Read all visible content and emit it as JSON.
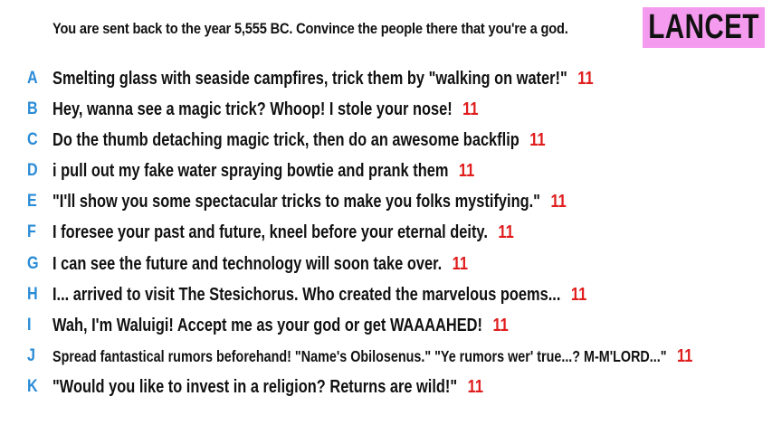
{
  "header": {
    "prompt": "You are sent back to the year 5,555 BC. Convince the people there that you're a god.",
    "badge": "LANCET"
  },
  "answers": [
    {
      "letter": "A",
      "text": "Smelting glass with seaside campfires, trick them by \"walking on water!\"",
      "score": "11"
    },
    {
      "letter": "B",
      "text": "Hey, wanna see a magic trick? Whoop! I stole your nose!",
      "score": "11"
    },
    {
      "letter": "C",
      "text": "Do the thumb detaching magic trick, then do an awesome backflip",
      "score": "11"
    },
    {
      "letter": "D",
      "text": "i pull out my fake water spraying bowtie and prank them",
      "score": "11"
    },
    {
      "letter": "E",
      "text": "\"I'll show you some spectacular tricks to make you folks mystifying.\"",
      "score": "11"
    },
    {
      "letter": "F",
      "text": "I foresee your past and future, kneel before your eternal deity.",
      "score": "11"
    },
    {
      "letter": "G",
      "text": "I can see the future and technology will soon take over.",
      "score": "11"
    },
    {
      "letter": "H",
      "text": "I... arrived to visit The Stesichorus. Who created the marvelous poems...",
      "score": "11"
    },
    {
      "letter": "I",
      "text": "Wah, I'm Waluigi! Accept me as your god or get WAAAAHED!",
      "score": "11"
    },
    {
      "letter": "J",
      "text": "Spread fantastical rumors beforehand! \"Name's Obilosenus.\" \"Ye rumors wer' true...? M-M'LORD...\"",
      "score": "11"
    },
    {
      "letter": "K",
      "text": "\"Would you like to invest in a religion? Returns are wild!\"",
      "score": "11"
    }
  ],
  "colors": {
    "letter": "#2a8bd6",
    "score": "#e01c1c",
    "badge_bg": "#f59bef"
  }
}
